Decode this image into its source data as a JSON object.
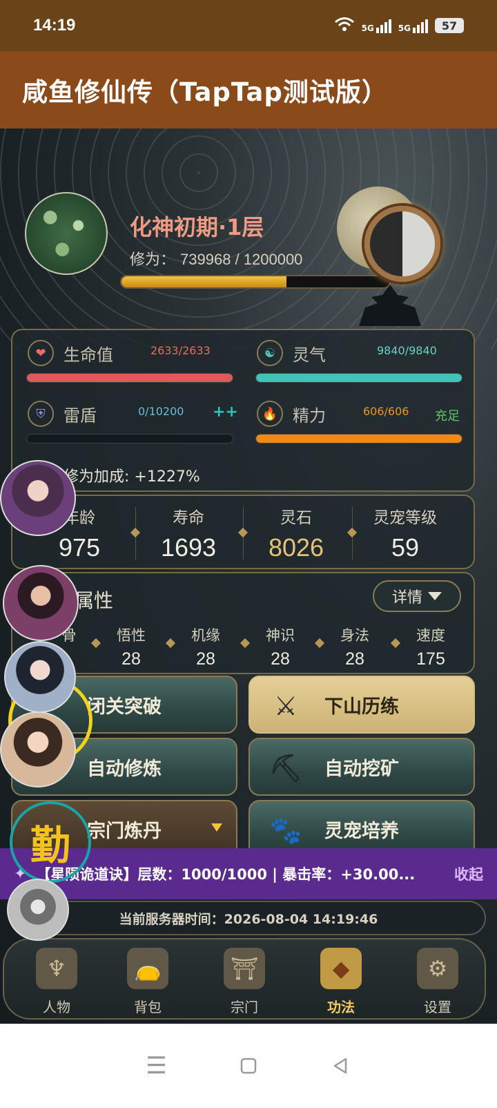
{
  "status_bar": {
    "time": "14:19",
    "net1": "5G",
    "net2": "5G",
    "battery": "57"
  },
  "app": {
    "title": "咸鱼修仙传（TapTap测试版）"
  },
  "player": {
    "realm": "化神初期·1层",
    "cultivation_label": "修为：",
    "cultivation_value": "739968 / 1200000",
    "cultivation_progress": 0.6166
  },
  "stats": {
    "hp": {
      "label": "生命值",
      "value": "2633/2633",
      "progress": 1.0,
      "color": "#e05a5a"
    },
    "qi": {
      "label": "灵气",
      "value": "9840/9840",
      "progress": 1.0,
      "color": "#42c3b7"
    },
    "shield": {
      "label": "雷盾",
      "value": "0/10200",
      "extra": "++",
      "progress": 0.0
    },
    "energy": {
      "label": "精力",
      "value": "606/606",
      "status": "充足",
      "progress": 1.0,
      "color": "#f08a12"
    },
    "bonus": "修为加成: +1227%"
  },
  "info": [
    {
      "label": "年龄",
      "value": "975"
    },
    {
      "label": "寿命",
      "value": "1693"
    },
    {
      "label": "灵石",
      "value": "8026"
    },
    {
      "label": "灵宠等级",
      "value": "59"
    }
  ],
  "attributes": {
    "title": "属性",
    "detail_label": "详情",
    "items": [
      {
        "label": "骨",
        "value": ""
      },
      {
        "label": "悟性",
        "value": "28"
      },
      {
        "label": "机缘",
        "value": "28"
      },
      {
        "label": "神识",
        "value": "28"
      },
      {
        "label": "身法",
        "value": "28"
      },
      {
        "label": "速度",
        "value": "175"
      }
    ]
  },
  "actions": {
    "breakthrough": "闭关突破",
    "adventure": "下山历练",
    "auto_cultivate": "自动修炼",
    "auto_mine": "自动挖矿",
    "sect_alchemy": "宗门炼丹",
    "pet_training": "灵宠培养"
  },
  "banner": {
    "text": "【星陨诡道诀】层数：1000/1000 | 暴击率：+30.00...",
    "collapse": "收起"
  },
  "server_time": "当前服务器时间：2026-08-04 14:19:46",
  "floating": {
    "diligence": "勤"
  },
  "tabs": [
    {
      "label": "人物",
      "icon": "character-icon"
    },
    {
      "label": "背包",
      "icon": "bag-icon"
    },
    {
      "label": "宗门",
      "icon": "sect-icon"
    },
    {
      "label": "功法",
      "icon": "scroll-icon",
      "active": true
    },
    {
      "label": "设置",
      "icon": "gear-icon"
    }
  ]
}
